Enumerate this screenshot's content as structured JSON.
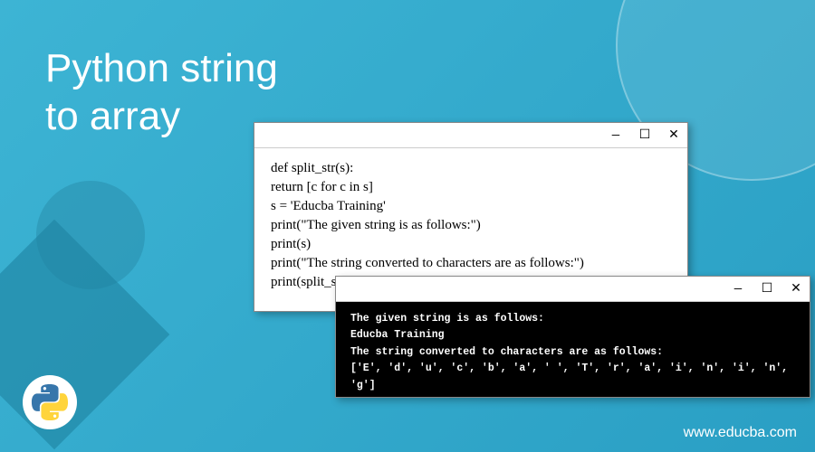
{
  "title_line1": "Python string",
  "title_line2": "to array",
  "code_window": {
    "lines": [
      "def split_str(s):",
      "return [c for c in s]",
      "s = 'Educba Training'",
      "print(\"The given string is as follows:\")",
      "print(s)",
      "print(\"The string converted to characters are as follows:\")",
      "print(split_str(s))"
    ]
  },
  "terminal_window": {
    "lines": [
      "The given string is as follows:",
      "Educba Training",
      "The string converted to characters are as follows:",
      "['E', 'd', 'u', 'c', 'b', 'a', ' ', 'T', 'r', 'a', 'i', 'n', 'i', 'n', 'g']"
    ]
  },
  "window_controls": {
    "minimize": "—",
    "maximize": "☐",
    "close": "✕"
  },
  "website": "www.educba.com",
  "logo_name": "python-logo"
}
